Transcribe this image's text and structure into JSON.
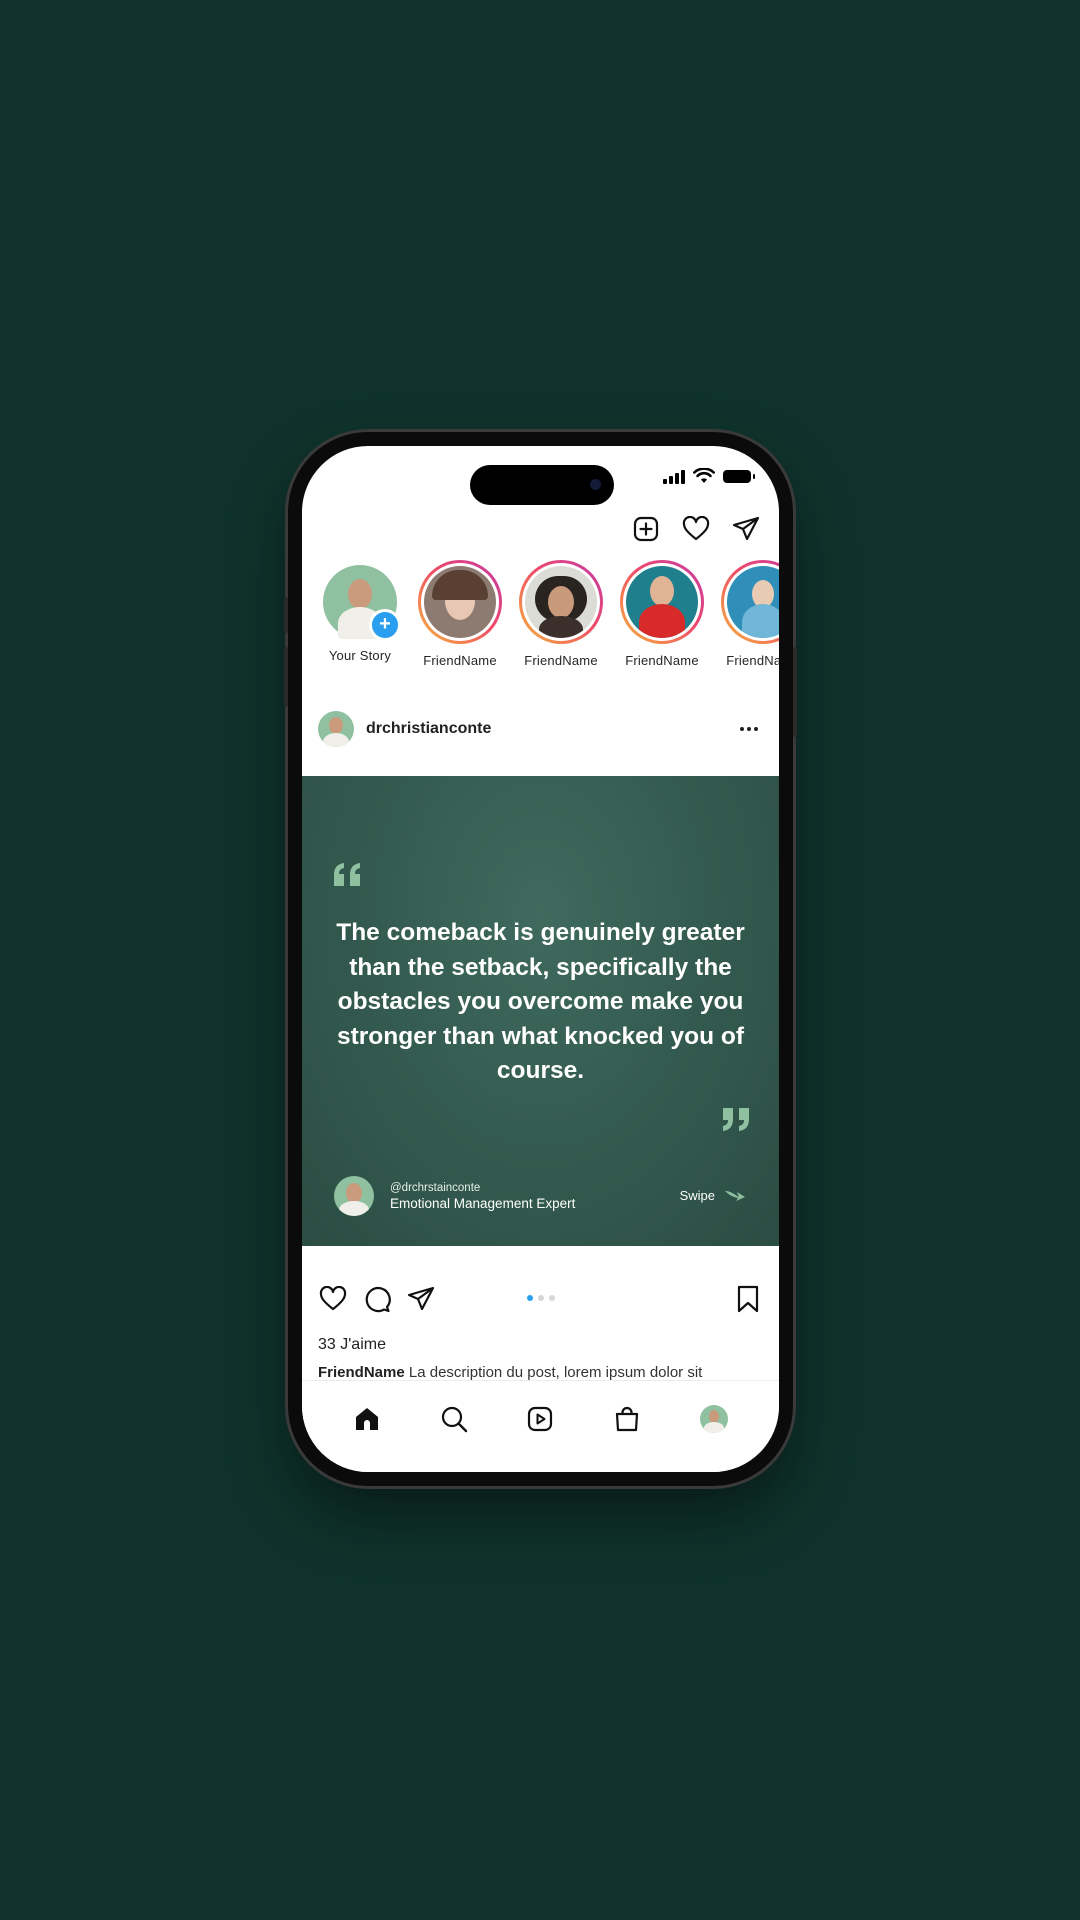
{
  "colors": {
    "page_background": "#0f332c",
    "post_background": "#33594e",
    "accent_blue": "#2a9ff0",
    "quote_mark": "#8fc1a1"
  },
  "status_bar": {
    "icons": [
      "signal-icon",
      "wifi-icon",
      "battery-icon"
    ]
  },
  "top_actions": [
    "add-post-icon",
    "heart-icon",
    "send-icon"
  ],
  "stories": [
    {
      "name": "Your Story",
      "own": true
    },
    {
      "name": "FriendName"
    },
    {
      "name": "FriendName"
    },
    {
      "name": "FriendName"
    },
    {
      "name": "FriendName"
    }
  ],
  "post": {
    "username": "drchristianconte",
    "quote": "The comeback is genuinely greater than the setback, specifically the obstacles you overcome make you stronger than what knocked you of course.",
    "author_handle": "@drchrstainconte",
    "author_role": "Emotional Management Expert",
    "swipe_label": "Swipe",
    "likes": "33 J'aime",
    "caption_user": "FriendName",
    "caption_text": "La description du post, lorem ipsum dolor sit",
    "carousel_dots": 3,
    "carousel_active": 1
  },
  "tabbar": [
    "home-icon",
    "search-icon",
    "reels-icon",
    "shop-icon",
    "profile-avatar"
  ]
}
